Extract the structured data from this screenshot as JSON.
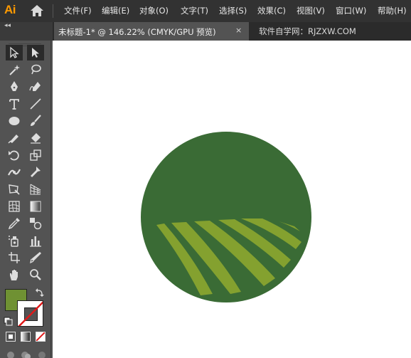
{
  "app": {
    "logo": "Ai"
  },
  "menu": {
    "items": [
      "文件(F)",
      "编辑(E)",
      "对象(O)",
      "文字(T)",
      "选择(S)",
      "效果(C)",
      "视图(V)",
      "窗口(W)",
      "帮助(H)"
    ]
  },
  "tabs": {
    "collapse_label": "◂◂",
    "active": {
      "title": "未标题-1* @ 146.22% (CMYK/GPU 预览)",
      "close_label": "×"
    },
    "inactive": {
      "title": "软件自学网：RJZXW.COM"
    }
  },
  "swatches": {
    "fill_color": "#6f9133",
    "stroke": "none"
  },
  "artwork": {
    "circle_color": "#3a6b35",
    "stripe_color": "#84a12f"
  }
}
